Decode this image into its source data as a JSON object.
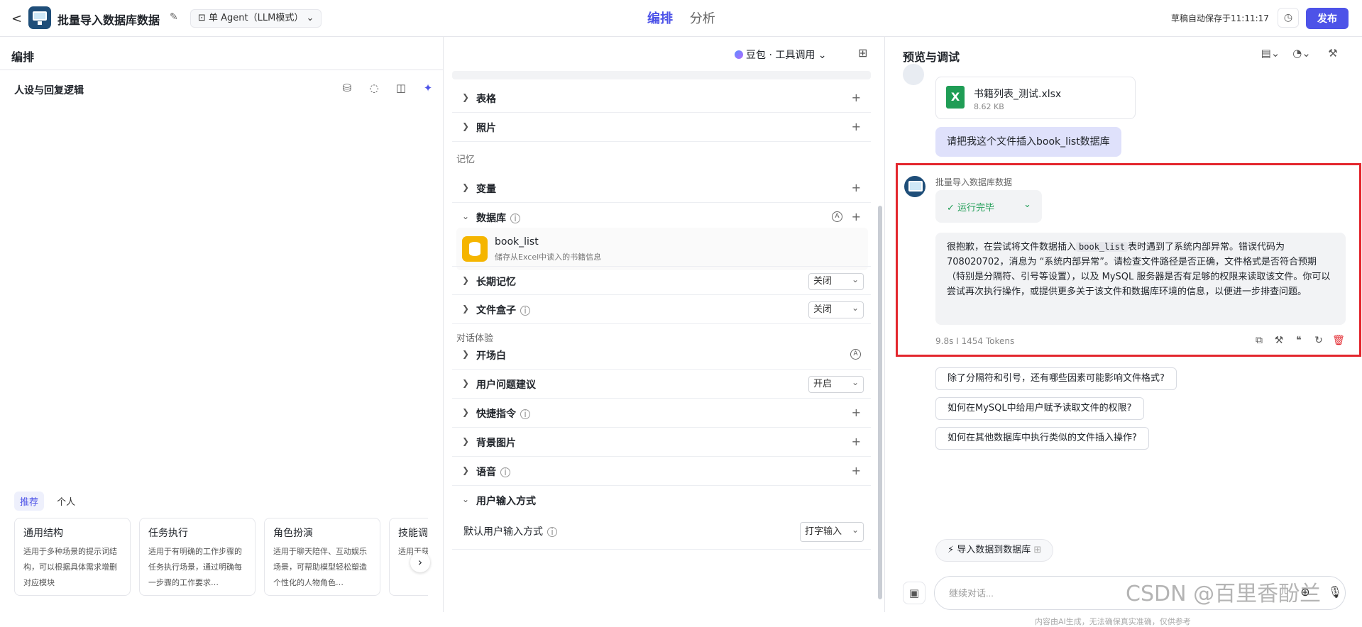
{
  "header": {
    "back": "<",
    "app_title": "批量导入数据库数据",
    "mode": "单 Agent（LLM模式）",
    "tabs": [
      "编排",
      "分析"
    ],
    "autosave": "草稿自动保存于11:11:17",
    "publish": "发布"
  },
  "left": {
    "section_title": "编排",
    "persona_title": "人设与回复逻辑",
    "template_tabs": [
      "推荐",
      "个人"
    ],
    "cards": [
      {
        "title": "通用结构",
        "desc": "适用于多种场景的提示词结构，可以根据具体需求增删对应模块"
      },
      {
        "title": "任务执行",
        "desc": "适用于有明确的工作步骤的任务执行场景，通过明确每一步骤的工作要求…"
      },
      {
        "title": "角色扮演",
        "desc": "适用于聊天陪伴、互动娱乐场景，可帮助模型轻松塑造个性化的人物角色…"
      },
      {
        "title": "技能调",
        "desc": "适用于获取…的场景"
      }
    ]
  },
  "middle": {
    "model": "豆包 · 工具调用",
    "rows": {
      "table": "表格",
      "photo": "照片",
      "variable": "变量",
      "database": "数据库",
      "long_memory": "长期记忆",
      "file_box": "文件盒子",
      "opening": "开场白",
      "suggestion": "用户问题建议",
      "shortcut": "快捷指令",
      "bg_image": "背景图片",
      "voice": "语音",
      "input_mode": "用户输入方式",
      "default_input": "默认用户输入方式"
    },
    "groups": {
      "memory": "记忆",
      "dialog": "对话体验"
    },
    "db": {
      "name": "book_list",
      "desc": "储存从Excel中读入的书籍信息"
    },
    "values": {
      "long_memory": "关闭",
      "file_box": "关闭",
      "suggestion": "开启",
      "default_input": "打字输入"
    }
  },
  "right": {
    "title": "预览与调试",
    "file": {
      "name": "书籍列表_测试.xlsx",
      "size": "8.62 KB"
    },
    "user_message": "请把我这个文件插入book_list数据库",
    "bot_name": "批量导入数据库数据",
    "status": "运行完毕",
    "reply_before": "很抱歉，在尝试将文件数据插入",
    "reply_code": "book_list",
    "reply_after": "表时遇到了系统内部异常。错误代码为708020702，消息为 “系统内部异常”。请检查文件路径是否正确，文件格式是否符合预期（特别是分隔符、引号等设置），以及 MySQL 服务器是否有足够的权限来读取该文件。你可以尝试再次执行操作，或提供更多关于该文件和数据库环境的信息，以便进一步排查问题。",
    "meta": "9.8s  I  1454 Tokens",
    "suggestions": [
      "除了分隔符和引号，还有哪些因素可能影响文件格式?",
      "如何在MySQL中给用户赋予读取文件的权限?",
      "如何在其他数据库中执行类似的文件插入操作?"
    ],
    "shortcut": "导入数据到数据库",
    "input_placeholder": "继续对话...",
    "disclaimer": "内容由AI生成，无法确保真实准确，仅供参考"
  },
  "watermark": "CSDN @百里香酚兰"
}
